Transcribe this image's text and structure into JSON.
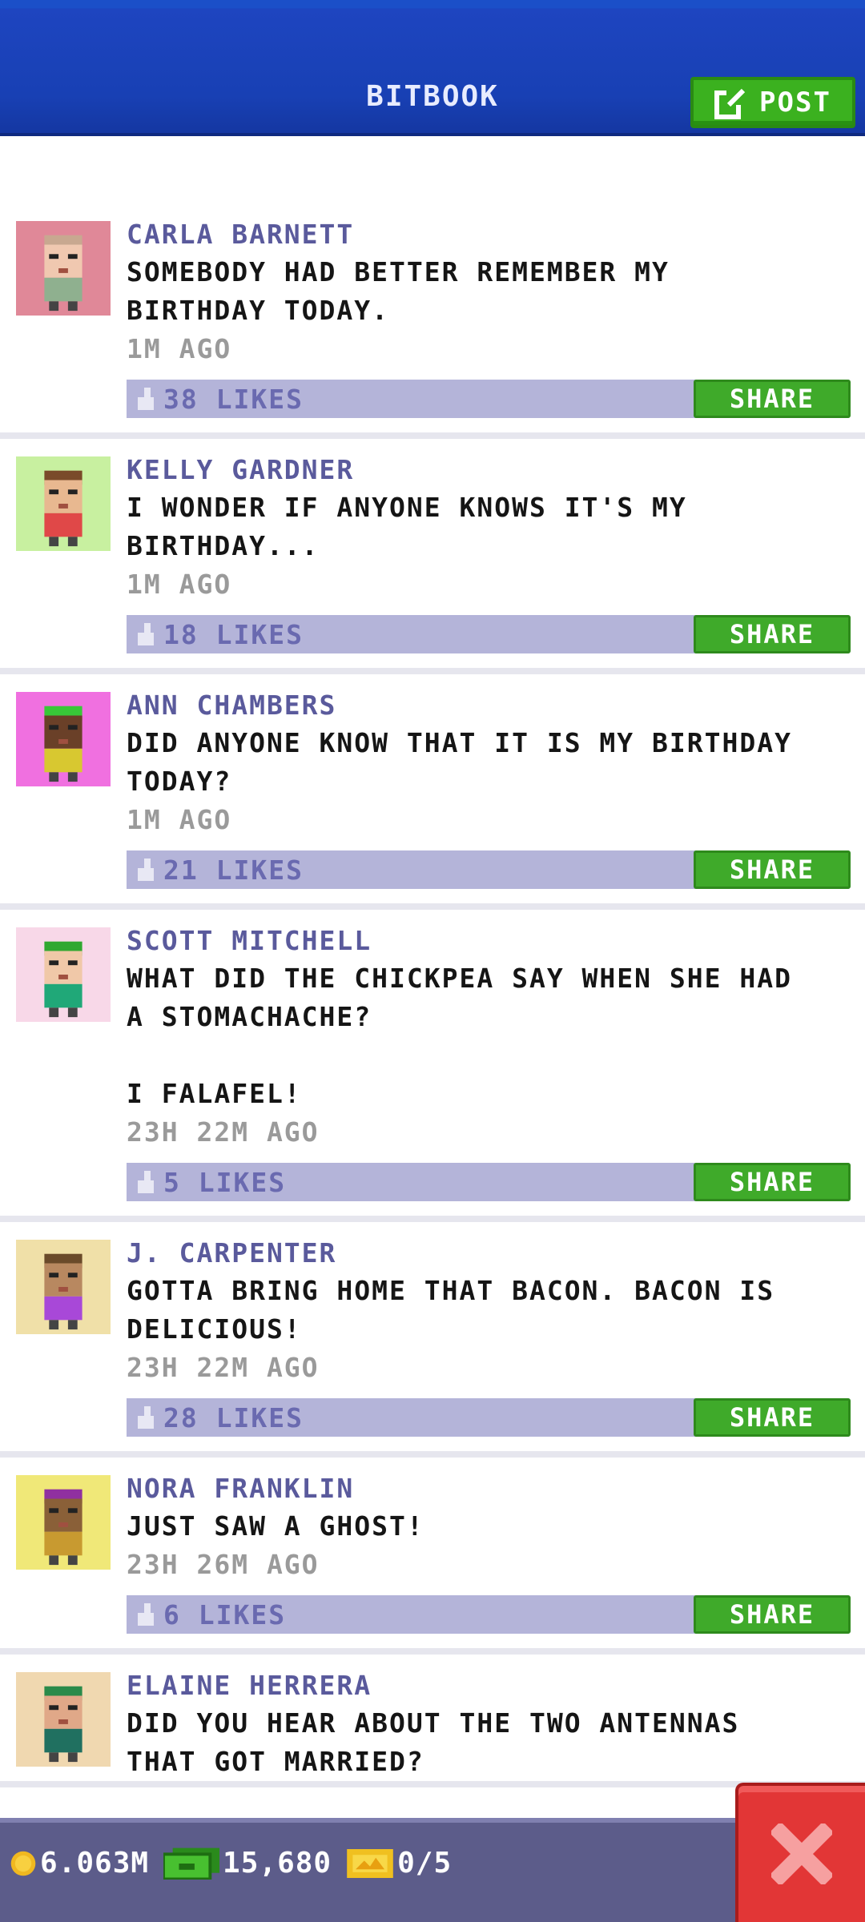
{
  "header": {
    "title": "BITBOOK",
    "post_label": "POST"
  },
  "posts": [
    {
      "author": "CARLA BARNETT",
      "text": "SOMEBODY HAD BETTER REMEMBER MY\nBIRTHDAY TODAY.",
      "time": "1M AGO",
      "likes": "38 LIKES",
      "share": "SHARE",
      "avatar_bg": "#e08898",
      "hair": "#c8a890",
      "shirt": "#8fb08f",
      "skin": "#f0c8b0"
    },
    {
      "author": "KELLY GARDNER",
      "text": "I WONDER IF ANYONE KNOWS IT'S MY\nBIRTHDAY...",
      "time": "1M AGO",
      "likes": "18 LIKES",
      "share": "SHARE",
      "avatar_bg": "#c8f0a0",
      "hair": "#7a4a2a",
      "shirt": "#e04848",
      "skin": "#e8b890"
    },
    {
      "author": "ANN CHAMBERS",
      "text": "DID ANYONE KNOW THAT IT IS MY BIRTHDAY\nTODAY?",
      "time": "1M AGO",
      "likes": "21 LIKES",
      "share": "SHARE",
      "avatar_bg": "#f070e0",
      "hair": "#38c838",
      "shirt": "#d8c830",
      "skin": "#6a4028"
    },
    {
      "author": "SCOTT MITCHELL",
      "text": "WHAT DID THE CHICKPEA SAY WHEN SHE HAD\nA STOMACHACHE?\n\nI FALAFEL!",
      "time": "23H 22M AGO",
      "likes": "5 LIKES",
      "share": "SHARE",
      "avatar_bg": "#f8d8e8",
      "hair": "#30a830",
      "shirt": "#20a878",
      "skin": "#f0c8a8"
    },
    {
      "author": "J. CARPENTER",
      "text": "GOTTA BRING HOME THAT BACON. BACON IS\nDELICIOUS!",
      "time": "23H 22M AGO",
      "likes": "28 LIKES",
      "share": "SHARE",
      "avatar_bg": "#f0e0a8",
      "hair": "#6a4a2a",
      "shirt": "#a848d8",
      "skin": "#b88860"
    },
    {
      "author": "NORA FRANKLIN",
      "text": "JUST SAW A GHOST!",
      "time": "23H 26M AGO",
      "likes": "6 LIKES",
      "share": "SHARE",
      "avatar_bg": "#f0e878",
      "hair": "#9030a0",
      "shirt": "#c89a30",
      "skin": "#8a6038"
    },
    {
      "author": "ELAINE HERRERA",
      "text": "DID YOU HEAR ABOUT THE TWO ANTENNAS\nTHAT GOT MARRIED?",
      "time": "",
      "likes": "",
      "share": "",
      "avatar_bg": "#f0d8b0",
      "hair": "#2a8a4a",
      "shirt": "#207060",
      "skin": "#e0a888"
    }
  ],
  "footer": {
    "coins": "6.063M",
    "bux": "15,680",
    "tickets": "0/5"
  },
  "colors": {
    "header_blue": "#1b4fc8",
    "post_green": "#3bb11f",
    "like_bar": "#b4b4d9",
    "close_red": "#e23636"
  }
}
